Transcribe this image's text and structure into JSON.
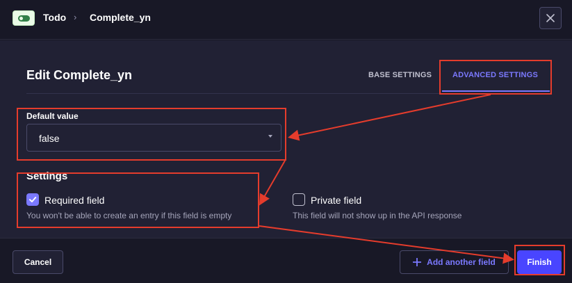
{
  "header": {
    "breadcrumb": [
      "Todo",
      "Complete_yn"
    ],
    "separator": "›",
    "close_icon": "close-icon"
  },
  "modal": {
    "title": "Edit Complete_yn",
    "tabs": [
      {
        "label": "BASE SETTINGS",
        "active": false
      },
      {
        "label": "ADVANCED SETTINGS",
        "active": true
      }
    ]
  },
  "default_value": {
    "label": "Default value",
    "value": "false"
  },
  "settings": {
    "title": "Settings",
    "required": {
      "label": "Required field",
      "checked": true,
      "hint": "You won't be able to create an entry if this field is empty"
    },
    "private": {
      "label": "Private field",
      "checked": false,
      "hint": "This field will not show up in the API response"
    }
  },
  "footer": {
    "cancel_label": "Cancel",
    "add_label": "Add another field",
    "finish_label": "Finish"
  },
  "colors": {
    "accent": "#7b79ff",
    "primary_button": "#4945ff",
    "annotation": "#e53c2c",
    "badge_green": "#328048"
  }
}
